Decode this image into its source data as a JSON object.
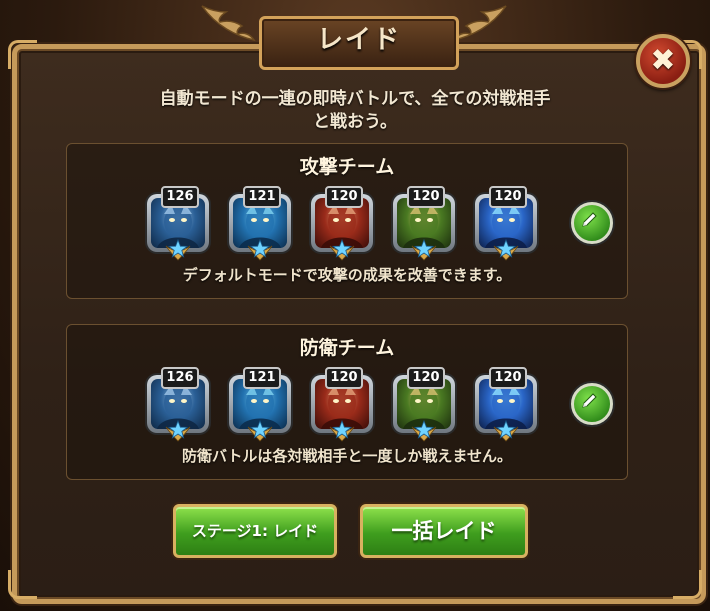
{
  "title": "レイド",
  "description_line1": "自動モードの一連の即時バトルで、全ての対戦相手",
  "description_line2": "と戦おう。",
  "attack_team": {
    "title": "攻撃チーム",
    "note": "デフォルトモードで攻撃の成果を改善できます。",
    "heroes": [
      {
        "level": "126",
        "palette": "blue-armor"
      },
      {
        "level": "121",
        "palette": "blue-dragon"
      },
      {
        "level": "120",
        "palette": "red-demon"
      },
      {
        "level": "120",
        "palette": "green-warrior"
      },
      {
        "level": "120",
        "palette": "blue-spirit"
      }
    ]
  },
  "defense_team": {
    "title": "防衛チーム",
    "note": "防衛バトルは各対戦相手と一度しか戦えません。",
    "heroes": [
      {
        "level": "126",
        "palette": "blue-armor"
      },
      {
        "level": "121",
        "palette": "blue-dragon"
      },
      {
        "level": "120",
        "palette": "red-demon"
      },
      {
        "level": "120",
        "palette": "green-warrior"
      },
      {
        "level": "120",
        "palette": "blue-spirit"
      }
    ]
  },
  "buttons": {
    "stage_raid": "ステージ1: レイド",
    "bulk_raid": "一括レイド"
  },
  "icons": {
    "close": "close-icon",
    "edit": "pencil-icon",
    "star": "star-badge-icon"
  },
  "colors": {
    "frame_gold": "#c59a5a",
    "button_green": "#3f9e1e",
    "close_red": "#b2301c"
  }
}
